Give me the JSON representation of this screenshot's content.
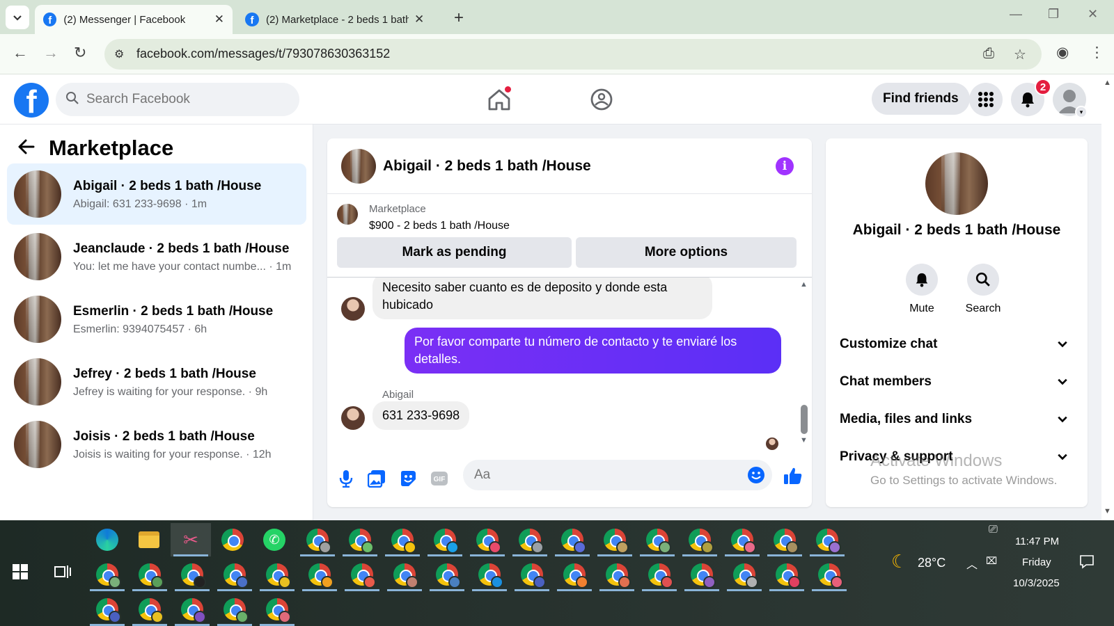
{
  "browser": {
    "tabs": [
      {
        "title": "(2) Messenger | Facebook",
        "active": true
      },
      {
        "title": "(2) Marketplace - 2 beds 1 bath",
        "active": false
      }
    ],
    "url": "facebook.com/messages/t/793078630363152"
  },
  "header": {
    "search_placeholder": "Search Facebook",
    "find_friends": "Find friends",
    "notifications_count": "2"
  },
  "sidebar": {
    "title": "Marketplace",
    "conversations": [
      {
        "name": "Abigail · 2 beds 1 bath /House",
        "preview": "Abigail: 631 233-9698 · 1m",
        "selected": true
      },
      {
        "name": "Jeanclaude · 2 beds 1 bath /House",
        "preview": "You: let me have your contact numbe... · 1m",
        "selected": false
      },
      {
        "name": "Esmerlin · 2 beds 1 bath /House",
        "preview": "Esmerlin: 9394075457 · 6h",
        "selected": false
      },
      {
        "name": "Jefrey · 2 beds 1 bath /House",
        "preview": "Jefrey is waiting for your response. · 9h",
        "selected": false
      },
      {
        "name": "Joisis · 2 beds 1 bath /House",
        "preview": "Joisis is waiting for your response. · 12h",
        "selected": false
      }
    ]
  },
  "chat": {
    "title": "Abigail · 2 beds 1 bath /House",
    "listing": {
      "label": "Marketplace",
      "price_title": "$900 - 2 beds 1 bath /House",
      "mark_pending": "Mark as pending",
      "more_options": "More options"
    },
    "messages": [
      {
        "from": "them",
        "text": "Necesito saber cuanto es de deposito y donde esta hubicado"
      },
      {
        "from": "me",
        "text": "Por favor comparte tu número de contacto y te enviaré los detalles."
      },
      {
        "from": "them",
        "sender": "Abigail",
        "text": "631 233-9698"
      }
    ],
    "composer_placeholder": "Aa"
  },
  "info_panel": {
    "name": "Abigail · 2 beds 1 bath /House",
    "actions": {
      "mute": "Mute",
      "search": "Search"
    },
    "sections": [
      "Customize chat",
      "Chat members",
      "Media, files and links",
      "Privacy & support"
    ],
    "watermark_title": "Activate Windows",
    "watermark_sub": "Go to Settings to activate Windows."
  },
  "taskbar": {
    "weather": "28°C",
    "time": "11:47 PM",
    "day": "Friday",
    "date": "10/3/2025"
  },
  "colors": {
    "fb_blue": "#1877f2",
    "messenger_purple": "#a033ff",
    "selected_row": "#e7f3ff"
  }
}
